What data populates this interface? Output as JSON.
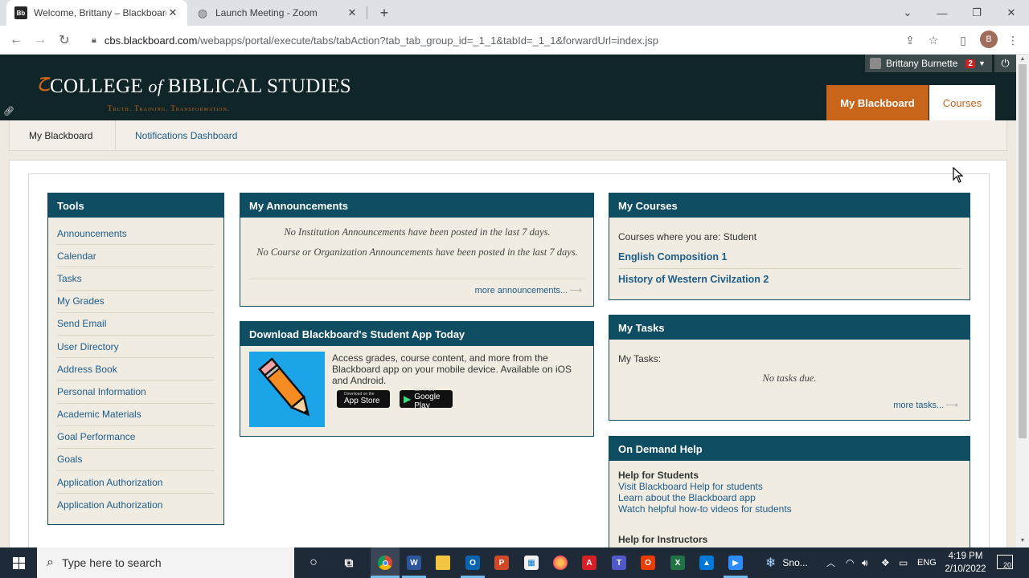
{
  "browser": {
    "tabs": [
      {
        "title": "Welcome, Brittany – Blackboard",
        "favicon": "Bb",
        "active": true
      },
      {
        "title": "Launch Meeting - Zoom",
        "favicon": "globe-icon",
        "active": false
      }
    ],
    "url_host": "cbs.blackboard.com",
    "url_path": "/webapps/portal/execute/tabs/tabAction?tab_tab_group_id=_1_1&tabId=_1_1&forwardUrl=index.jsp",
    "profile_initial": "B"
  },
  "header": {
    "logo_main_pre": "COLLEGE ",
    "logo_main_of": "of",
    "logo_main_post": " BIBLICAL STUDIES",
    "logo_tagline": "Truth. Training. Transformation.",
    "user_name": "Brittany Burnette",
    "notification_count": "2",
    "tab_myblackboard": "My Blackboard",
    "tab_courses": "Courses",
    "colors": {
      "header_bg": "#0f2528",
      "accent": "#c8651b",
      "module_head": "#0f4d63",
      "link": "#1b5c8a"
    }
  },
  "subnav": {
    "items": [
      "My Blackboard",
      "Notifications Dashboard"
    ]
  },
  "tools": {
    "title": "Tools",
    "items": [
      "Announcements",
      "Calendar",
      "Tasks",
      "My Grades",
      "Send Email",
      "User Directory",
      "Address Book",
      "Personal Information",
      "Academic Materials",
      "Goal Performance",
      "Goals",
      "Application Authorization",
      "Application Authorization"
    ]
  },
  "announcements": {
    "title": "My Announcements",
    "line1": "No Institution Announcements have been posted in the last 7 days.",
    "line2": "No Course or Organization Announcements have been posted in the last 7 days.",
    "more": "more announcements..."
  },
  "app": {
    "title": "Download Blackboard's Student App Today",
    "text": "Access grades, course content, and more from the Blackboard app on your mobile device. Available on iOS and Android.",
    "appstore_small": "Download on the",
    "appstore_big": "App Store",
    "googleplay_small": "GET IT ON",
    "googleplay_big": "Google Play"
  },
  "courses": {
    "title": "My Courses",
    "subtitle": "Courses where you are: Student",
    "items": [
      "English Composition 1",
      "History of Western Civilzation 2"
    ]
  },
  "tasks": {
    "title": "My Tasks",
    "label": "My Tasks:",
    "empty": "No tasks due.",
    "more": "more tasks..."
  },
  "help": {
    "title": "On Demand Help",
    "students_head": "Help for Students",
    "students_links": [
      "Visit Blackboard Help for students",
      "Learn about the Blackboard app",
      "Watch helpful how-to videos for students"
    ],
    "instructors_head": "Help for Instructors"
  },
  "taskbar": {
    "search_placeholder": "Type here to search",
    "weather": "Sno...",
    "language": "ENG",
    "time": "4:19 PM",
    "date": "2/10/2022",
    "notifications": "20"
  }
}
